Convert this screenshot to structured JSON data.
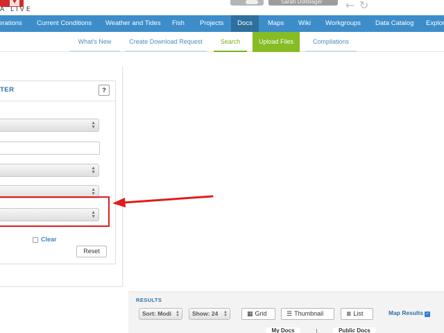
{
  "header": {
    "logo_text": "A LIVE",
    "user_label": "Sarah Doltslager"
  },
  "nav": {
    "items": [
      "erations",
      "Current Conditions",
      "Weather and Tides",
      "Fish",
      "Projects",
      "Docs",
      "Maps",
      "Wiki",
      "Workgroups",
      "Data Catalog",
      "Explor"
    ],
    "active": "Docs"
  },
  "subnav": {
    "items": [
      "What's New",
      "Create Download Request",
      "Search",
      "Upload Files",
      "Compilations"
    ],
    "active": "Search"
  },
  "filter": {
    "title": "TER",
    "help_label": "?",
    "clear_label": "Clear",
    "reset_label": "Reset"
  },
  "results": {
    "label": "RESULTS",
    "sort_label": "Sort: Modi",
    "show_label": "Show: 24",
    "grid_label": "Grid",
    "thumbnail_label": "Thumbnail",
    "list_label": "List",
    "map_results_label": "Map Results",
    "map_results_checked": true,
    "tabs": [
      "My Docs",
      "Public Docs"
    ]
  },
  "colors": {
    "nav_bg": "#3c8dca",
    "nav_active": "#2e6f9e",
    "upload_green": "#86bc24",
    "annotation_red": "#e31b1b",
    "link_blue": "#3b86c3"
  }
}
